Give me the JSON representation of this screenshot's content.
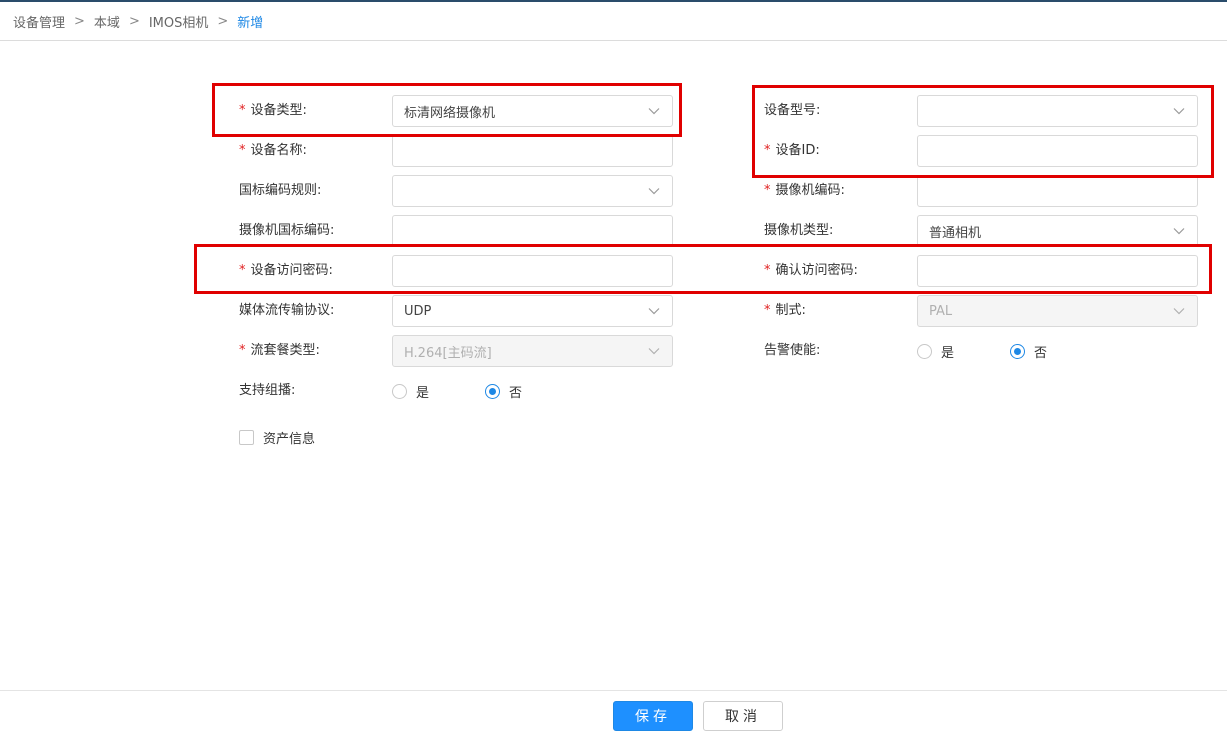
{
  "breadcrumb": [
    "设备管理",
    "本域",
    "IMOS相机",
    "新增"
  ],
  "breadcrumb_separator": ">",
  "form": {
    "device_type": {
      "label": "设备类型:",
      "required": true,
      "value": "标清网络摄像机"
    },
    "device_name": {
      "label": "设备名称:",
      "required": true,
      "value": ""
    },
    "gb_code_rule": {
      "label": "国标编码规则:",
      "required": false,
      "value": ""
    },
    "camera_gb_code": {
      "label": "摄像机国标编码:",
      "required": false,
      "value": ""
    },
    "access_password": {
      "label": "设备访问密码:",
      "required": true,
      "value": ""
    },
    "stream_protocol": {
      "label": "媒体流传输协议:",
      "required": false,
      "value": "UDP"
    },
    "stream_profile": {
      "label": "流套餐类型:",
      "required": true,
      "value": "H.264[主码流]"
    },
    "multicast": {
      "label": "支持组播:",
      "options": [
        "是",
        "否"
      ],
      "selected": "否"
    },
    "device_model": {
      "label": "设备型号:",
      "required": false,
      "value": ""
    },
    "device_id": {
      "label": "设备ID:",
      "required": true,
      "value": ""
    },
    "camera_code": {
      "label": "摄像机编码:",
      "required": true,
      "value": ""
    },
    "camera_type": {
      "label": "摄像机类型:",
      "required": false,
      "value": "普通相机"
    },
    "confirm_password": {
      "label": "确认访问密码:",
      "required": true,
      "value": ""
    },
    "video_standard": {
      "label": "制式:",
      "required": true,
      "value": "PAL"
    },
    "alarm_enable": {
      "label": "告警使能:",
      "options": [
        "是",
        "否"
      ],
      "selected": "否"
    },
    "asset_info": {
      "label": "资产信息",
      "checked": false
    },
    "required_mark": "*"
  },
  "buttons": {
    "save": "保存",
    "cancel": "取消"
  },
  "icons": {
    "dropdown": "chevron-down-icon"
  },
  "colors": {
    "accent": "#1e88e5",
    "required": "#e02020",
    "highlight": "#e00000"
  }
}
